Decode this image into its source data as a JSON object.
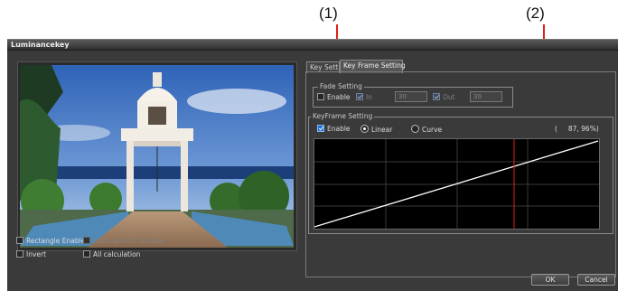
{
  "callouts": {
    "one": "(1)",
    "two": "(2)"
  },
  "window": {
    "title": "Luminancekey"
  },
  "left_options": {
    "rectangle_enable": "Rectangle Enable",
    "outside_rect_enable": "Outside Rect. Enable",
    "invert": "Invert",
    "all_calculation": "All calculation"
  },
  "tabs": [
    {
      "label": "Key Setti"
    },
    {
      "label": "Key Frame Setting"
    }
  ],
  "fade": {
    "title": "Fade Setting",
    "enable": "Enable",
    "in_label": "In",
    "in_value": "30",
    "out_label": "Out",
    "out_value": "30"
  },
  "keyframe": {
    "title": "KeyFrame Setting",
    "enable": "Enable",
    "linear": "Linear",
    "curve": "Curve",
    "position": "(     87, 96%)"
  },
  "graph": {
    "current_x_fraction": 0.7
  },
  "buttons": {
    "ok": "OK",
    "cancel": "Cancel"
  },
  "colors": {
    "accent": "#1e6fd9",
    "marker": "#e0201a",
    "window_bg": "#3a3a3a"
  }
}
